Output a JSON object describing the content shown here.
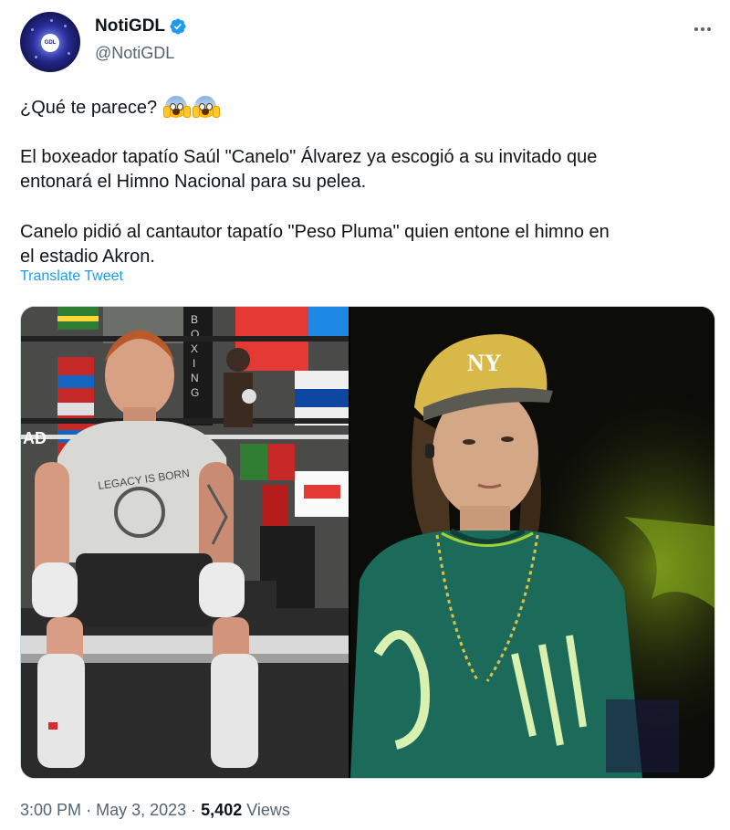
{
  "author": {
    "display_name": "NotiGDL",
    "handle": "@NotiGDL",
    "avatar_text": "GDL",
    "verified": true
  },
  "tweet": {
    "line1": "¿Qué te parece?",
    "line2": "El boxeador tapatío Saúl \"Canelo\" Álvarez ya escogió a su invitado que",
    "line3": "entonará el Himno Nacional para su pelea.",
    "line4": "Canelo pidió al cantautor tapatío \"Peso Pluma\" quien entone el himno en",
    "line5": "el estadio Akron.",
    "emojis": [
      "face-screaming-in-fear-icon",
      "face-screaming-in-fear-icon"
    ],
    "translate_label": "Translate Tweet"
  },
  "media": {
    "left_photo_texts": [
      "BOXING",
      "AD"
    ],
    "left_shirt_text": "LEGACY IS BORN",
    "right_cap_text": "NY"
  },
  "footer": {
    "time": "3:00 PM",
    "separator": "·",
    "date": "May 3, 2023",
    "views_count": "5,402",
    "views_label": "Views"
  },
  "colors": {
    "link": "#1d9bf0",
    "secondary_text": "#536471",
    "verified_badge": "#1d9bf0"
  }
}
